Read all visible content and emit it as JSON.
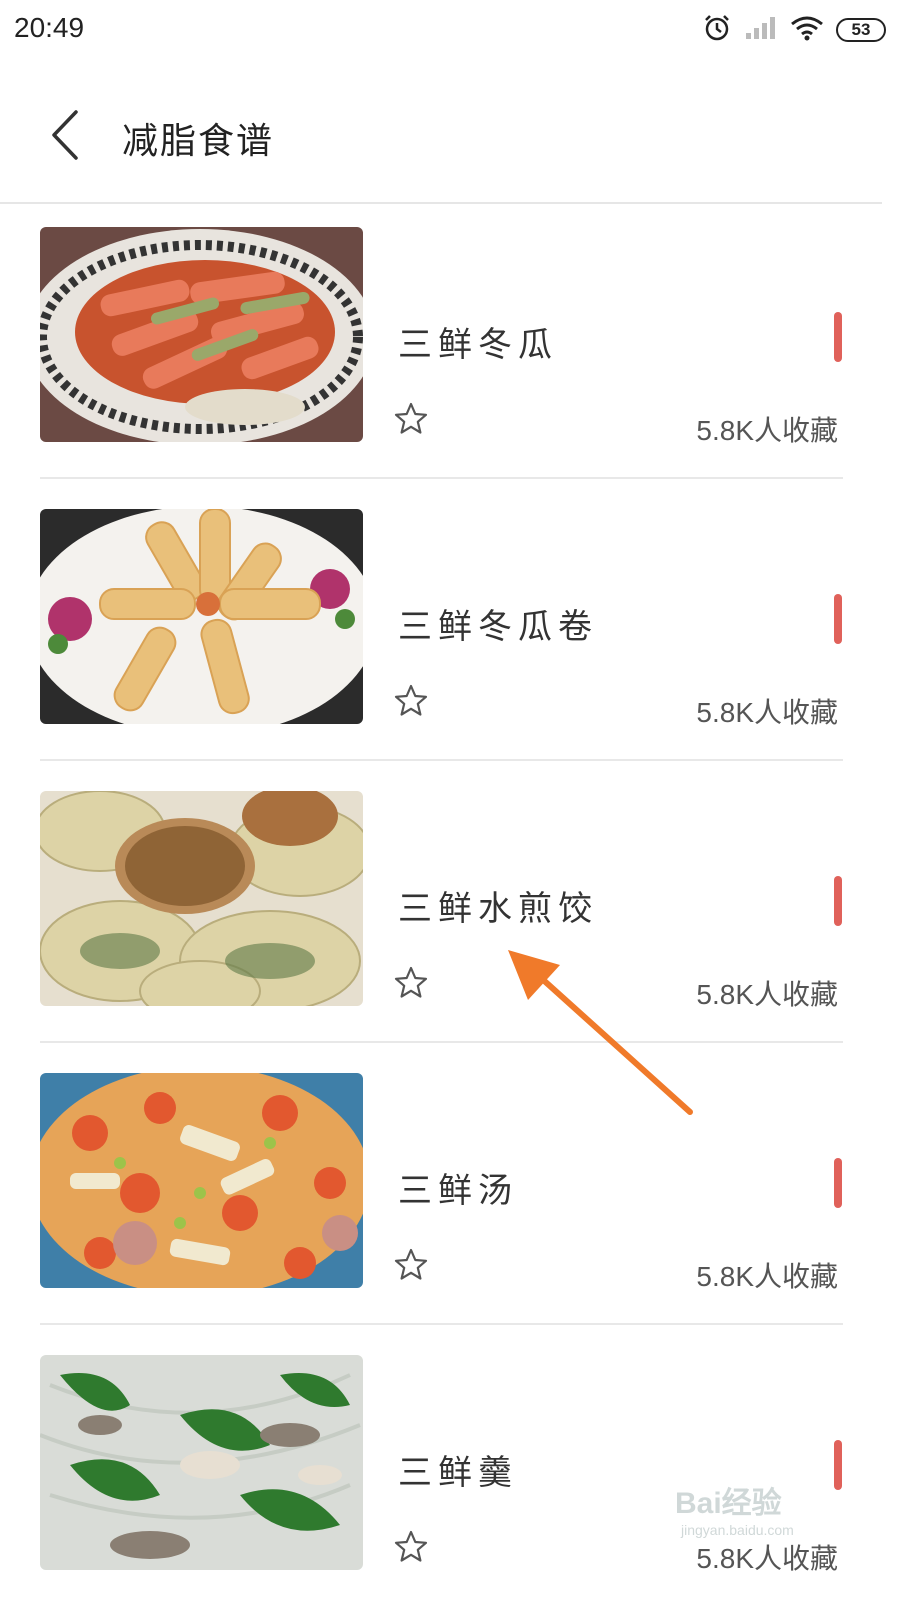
{
  "status_bar": {
    "time": "20:49",
    "battery": "53",
    "icons": [
      "alarm-icon",
      "signal-icon",
      "wifi-icon",
      "battery-icon"
    ]
  },
  "header": {
    "back_icon": "chevron-left-icon",
    "title": "减脂食谱"
  },
  "recipes": [
    {
      "name": "三鲜冬瓜",
      "favorites": "5.8K人收藏",
      "image": "braised-winter-melon-plate"
    },
    {
      "name": "三鲜冬瓜卷",
      "favorites": "5.8K人收藏",
      "image": "winter-melon-rolls-plate"
    },
    {
      "name": "三鲜水煎饺",
      "favorites": "5.8K人收藏",
      "image": "pan-fried-dumplings"
    },
    {
      "name": "三鲜汤",
      "favorites": "5.8K人收藏",
      "image": "three-delicacies-soup"
    },
    {
      "name": "三鲜羹",
      "favorites": "5.8K人收藏",
      "image": "three-delicacies-thick-soup"
    }
  ],
  "colors": {
    "accent_bar": "#e0615a",
    "annotation_arrow": "#f07a2a",
    "divider": "#e8e8e8"
  },
  "watermark": {
    "main": "Bai经验",
    "sub": "jingyan.baidu.com"
  }
}
